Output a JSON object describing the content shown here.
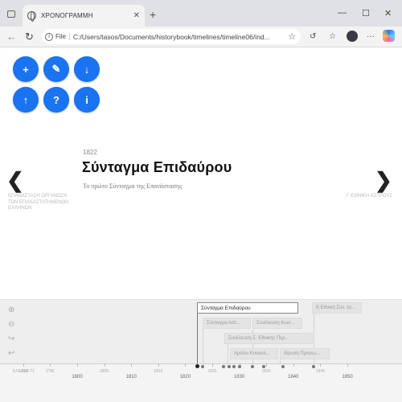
{
  "browser": {
    "tab_title": "ΧΡΟΝΟΓΡΑΜΜΗ",
    "tab_close": "✕",
    "new_tab": "+",
    "win_minimize": "—",
    "win_maximize": "☐",
    "win_close": "✕",
    "back": "←",
    "reload": "↻",
    "file_label": "File",
    "url": "C:/Users/tasos/Documents/historybook/timelines/timeline06/ind...",
    "menu": "···"
  },
  "toolbar": {
    "add": "+",
    "edit": "✎",
    "download": "↓",
    "upload": "↑",
    "help": "?",
    "info": "i"
  },
  "slide": {
    "year": "1822",
    "title": "Σύνταγμα Επιδαύρου",
    "subtitle": "Το πρώτο Σύνταγμα της Επανάστασης"
  },
  "nav": {
    "prev_arrow": "❮",
    "next_arrow": "❯",
    "prev_text": "ΕΠΑΝΑΣΤΑΣΗ ΟΡΓΑΝΩΣΗ ΤΩΝ ΕΠΑΝΑΣΤΑΤΗΜΕΝΩΝ ΕΛΛΗΝΩΝ",
    "next_text": "Γ ΕΘΝΙΚΗ ΑΣΤΡΟΥΣ"
  },
  "timeline": {
    "zoom_in": "+",
    "zoom_out": "−",
    "markers": [
      {
        "label": "Σύνταγμα Επιδαύρου",
        "active": true
      },
      {
        "label": "Β Εθνική Συν. Ισ...",
        "active": false
      },
      {
        "label": "Σύνταγμα Αστ...",
        "active": false
      },
      {
        "label": "Συνέλευση Κωσ...",
        "active": false
      },
      {
        "label": "Συνέλευση Σ. Εθνικής Περ...",
        "active": false
      },
      {
        "label": "Αρείου Κυνουλ...",
        "active": false
      },
      {
        "label": "Ιδρυση Προσω...",
        "active": false
      }
    ],
    "era_label": "ΕΛΛΑΔΑ ΤΣ",
    "minor_years": [
      "1790",
      "1795",
      "1805",
      "1815",
      "1825",
      "1835",
      "1845"
    ],
    "major_years": [
      "1800",
      "1810",
      "1820",
      "1830",
      "1840",
      "1850"
    ]
  },
  "colors": {
    "accent": "#1a73f0",
    "title": "#111111",
    "muted": "#bbbbbb"
  }
}
